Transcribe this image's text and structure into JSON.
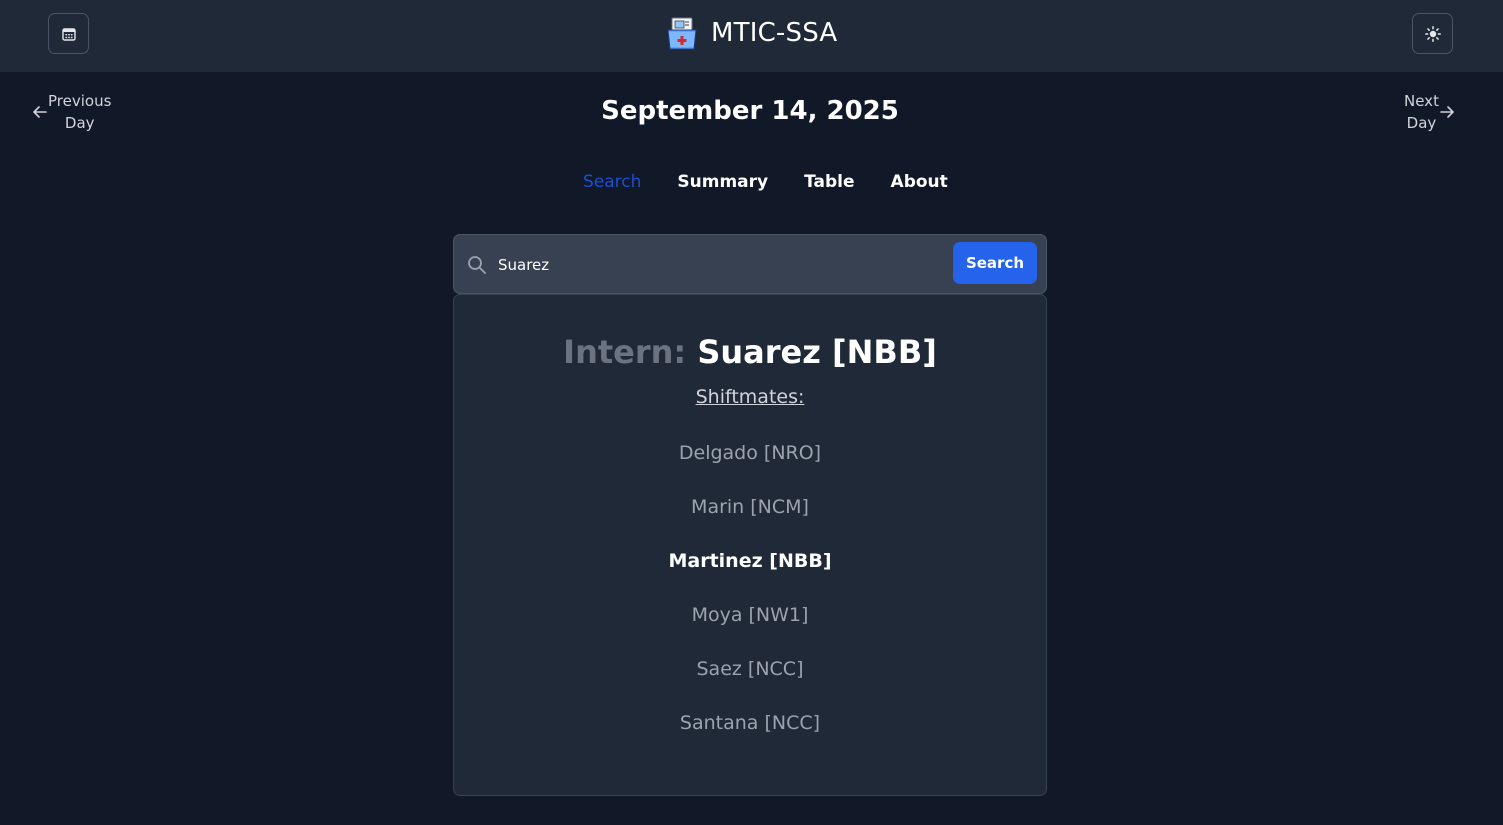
{
  "header": {
    "title": "MTIC-SSA",
    "logo_icon": "medical-folder-icon",
    "calendar_icon": "calendar-icon",
    "theme_icon": "sun-icon"
  },
  "day_nav": {
    "prev_line1": "Previous",
    "prev_line2": "Day",
    "next_line1": "Next",
    "next_line2": "Day"
  },
  "date": "September 14, 2025",
  "tabs": [
    {
      "label": "Search",
      "active": true
    },
    {
      "label": "Summary",
      "active": false
    },
    {
      "label": "Table",
      "active": false
    },
    {
      "label": "About",
      "active": false
    }
  ],
  "search": {
    "value": "Suarez",
    "button_label": "Search"
  },
  "result": {
    "intern_label": "Intern:",
    "intern_name": "Suarez [NBB]",
    "shiftmates_heading": "Shiftmates:",
    "shiftmates": [
      {
        "name": "Delgado [NRO]",
        "highlight": false
      },
      {
        "name": "Marin [NCM]",
        "highlight": false
      },
      {
        "name": "Martinez [NBB]",
        "highlight": true
      },
      {
        "name": "Moya [NW1]",
        "highlight": false
      },
      {
        "name": "Saez [NCC]",
        "highlight": false
      },
      {
        "name": "Santana [NCC]",
        "highlight": false
      }
    ]
  },
  "colors": {
    "page_bg": "#111827",
    "header_bg": "#1f2937",
    "accent": "#2563eb",
    "active_tab": "#1d4ed8"
  }
}
